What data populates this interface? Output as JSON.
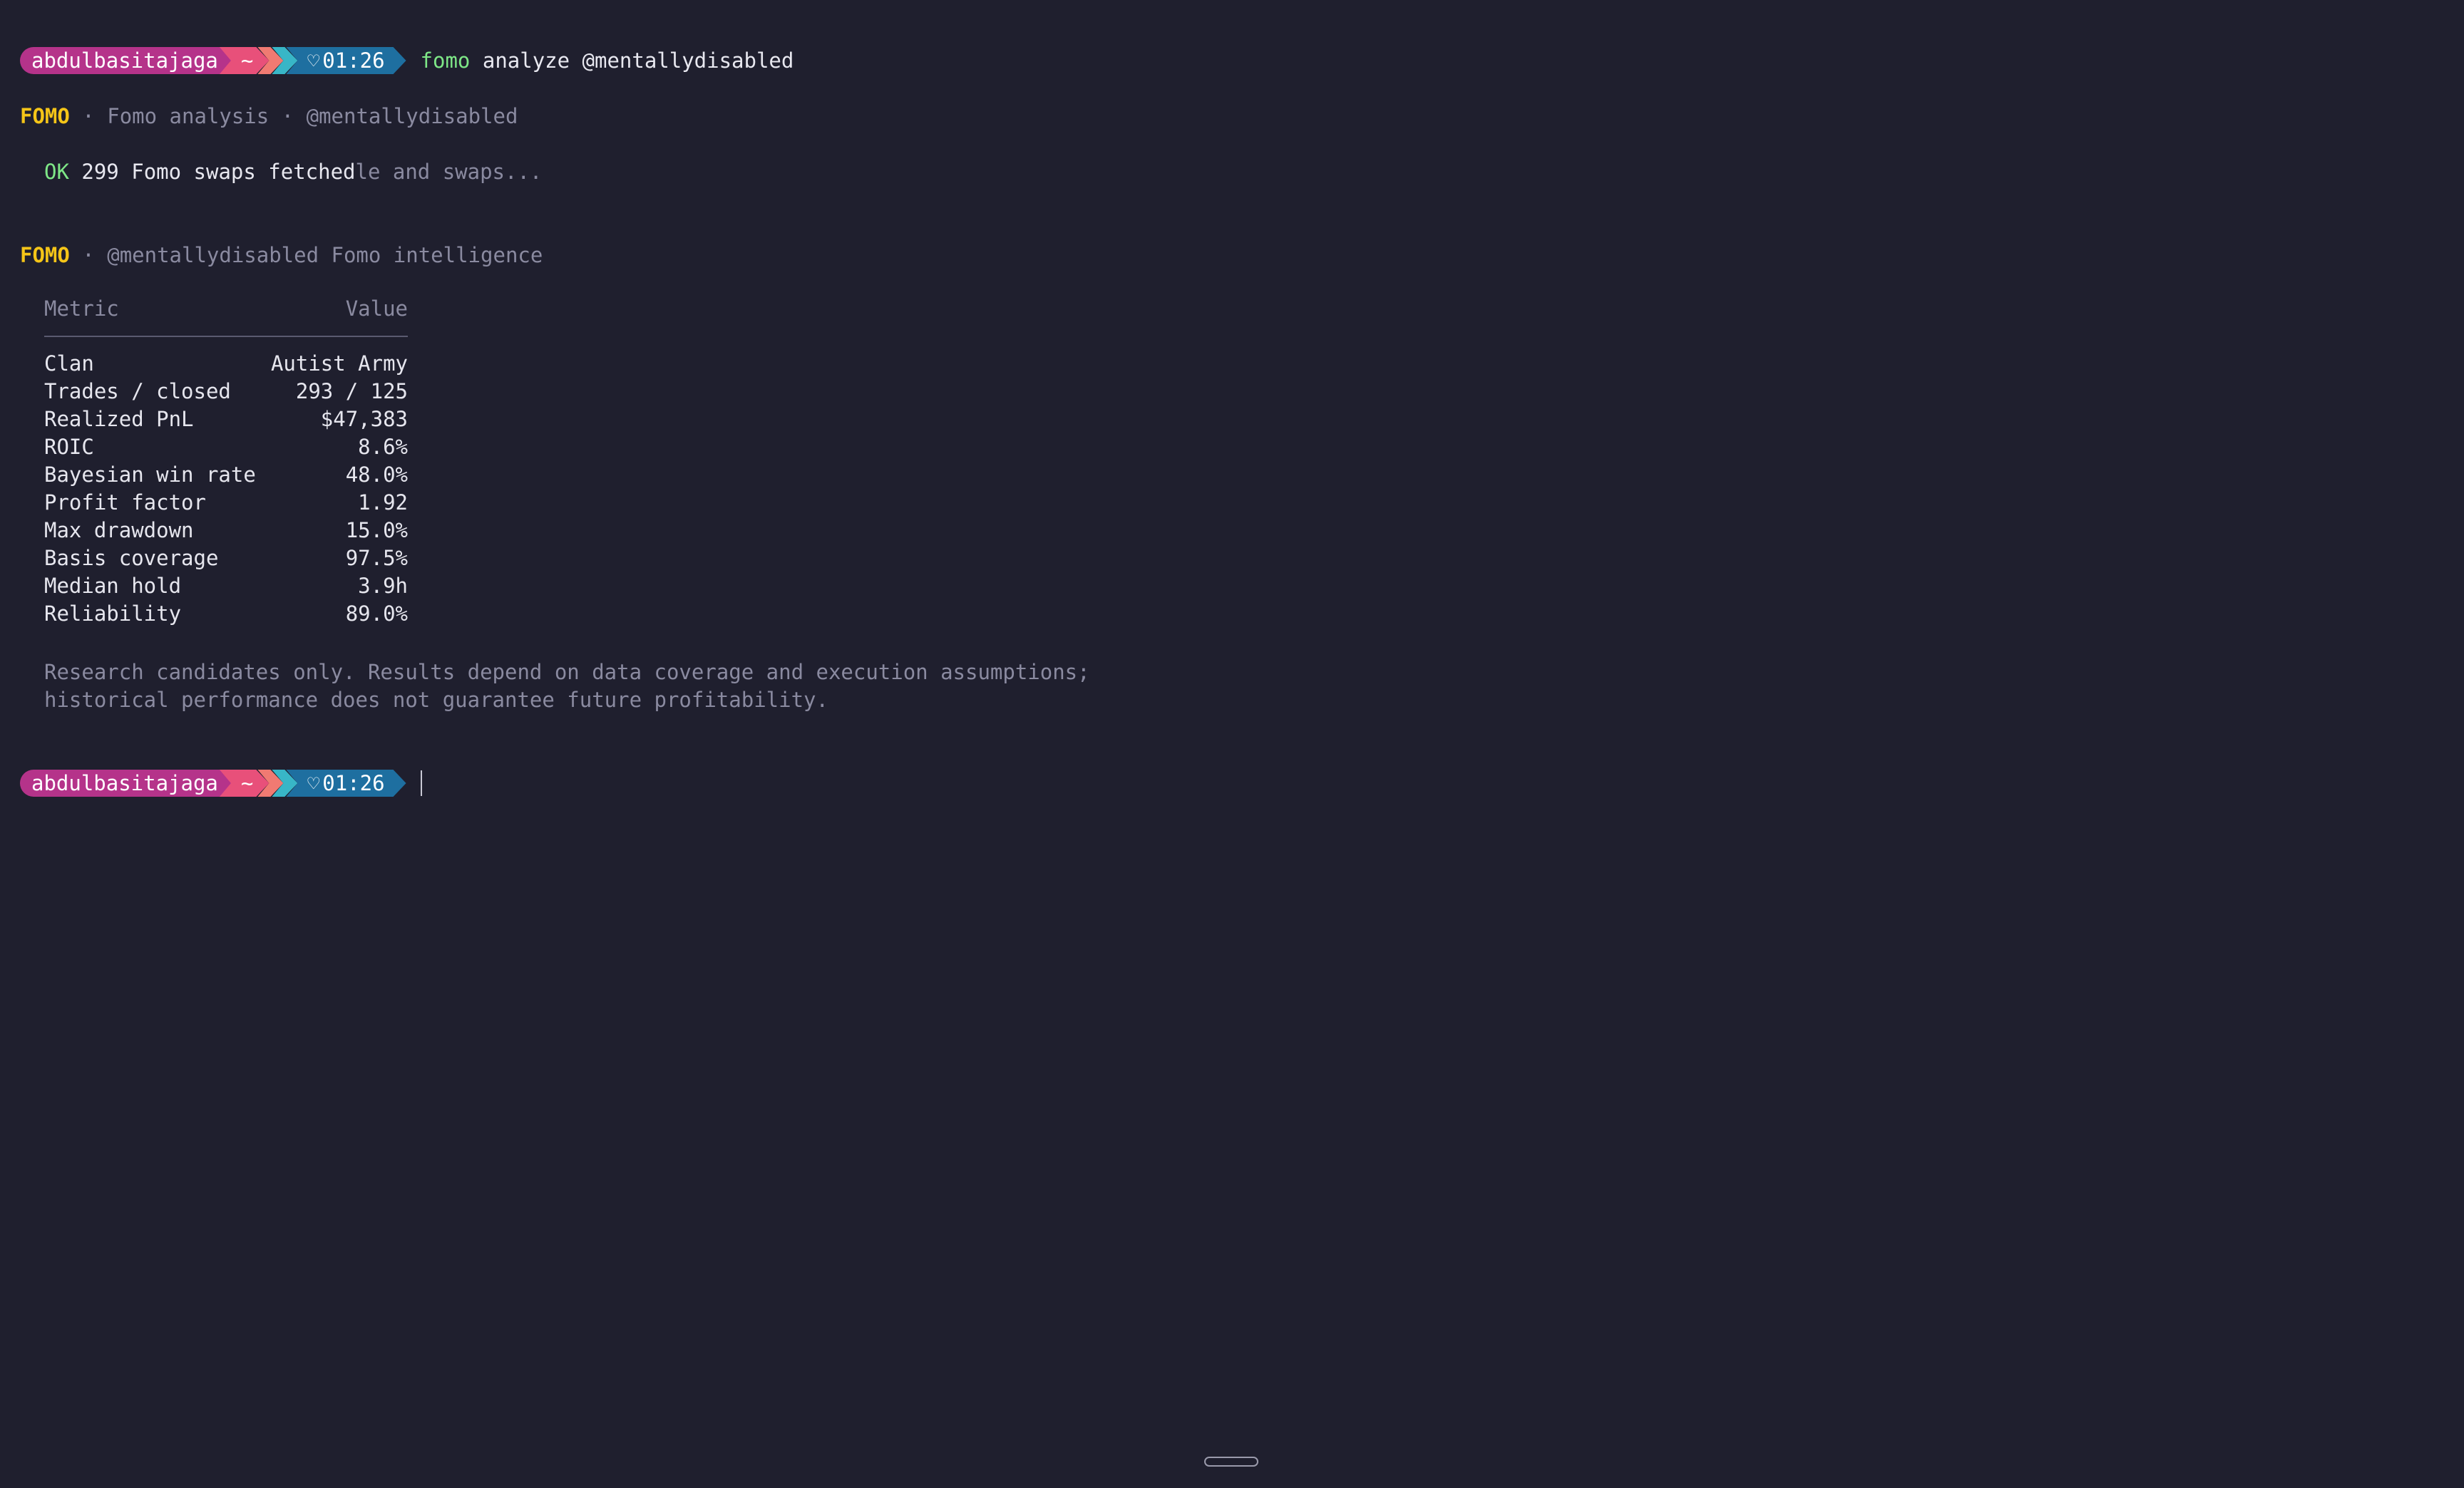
{
  "prompt": {
    "user": "abdulbasitajaga",
    "dir": "~",
    "time": "01:26",
    "heart_icon": "heart-outline-icon"
  },
  "command": {
    "name": "fomo",
    "args": "analyze @mentallydisabled"
  },
  "header1": {
    "brand": "FOMO",
    "sep": " · ",
    "title": "Fomo analysis",
    "sep2": " · ",
    "handle": "@mentallydisabled"
  },
  "status": {
    "ok": "OK",
    "message": "299 Fomo swaps fetched",
    "overwritten": "le and swaps..."
  },
  "header2": {
    "brand": "FOMO",
    "sep": " · ",
    "title": "@mentallydisabled Fomo intelligence"
  },
  "table": {
    "col_metric": "Metric",
    "col_value": "Value",
    "rows": [
      {
        "metric": "Clan",
        "value": "Autist Army"
      },
      {
        "metric": "Trades / closed",
        "value": "293 / 125"
      },
      {
        "metric": "Realized PnL",
        "value": "$47,383"
      },
      {
        "metric": "ROIC",
        "value": "8.6%"
      },
      {
        "metric": "Bayesian win rate",
        "value": "48.0%"
      },
      {
        "metric": "Profit factor",
        "value": "1.92"
      },
      {
        "metric": "Max drawdown",
        "value": "15.0%"
      },
      {
        "metric": "Basis coverage",
        "value": "97.5%"
      },
      {
        "metric": "Median hold",
        "value": "3.9h"
      },
      {
        "metric": "Reliability",
        "value": "89.0%"
      }
    ]
  },
  "disclaimer": {
    "line1": "Research candidates only. Results depend on data coverage and execution assumptions;",
    "line2": "historical performance does not guarantee future profitability."
  },
  "colors": {
    "background": "#1f1f2e",
    "user_segment": "#b5338a",
    "home_segment": "#e8507a",
    "time_segment": "#1e6fa0",
    "brand": "#f5c518",
    "ok": "#7ee787"
  }
}
